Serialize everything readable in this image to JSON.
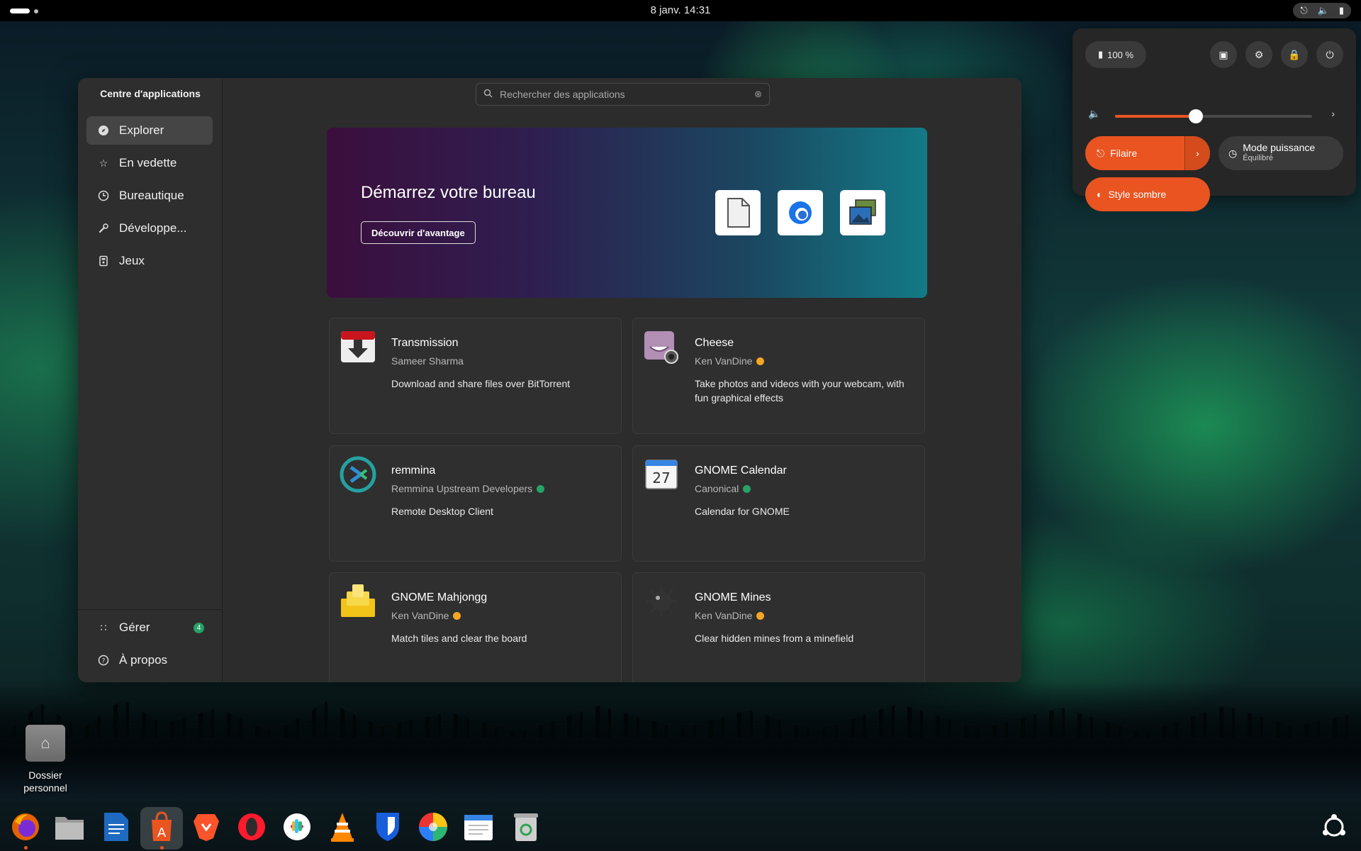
{
  "topbar": {
    "clock": "8 janv.  14:31"
  },
  "window": {
    "sidebar_title": "Centre d'applications",
    "nav": [
      {
        "label": "Explorer",
        "icon": "compass-icon",
        "active": true
      },
      {
        "label": "En vedette",
        "icon": "star-icon"
      },
      {
        "label": "Bureautique",
        "icon": "clock-icon"
      },
      {
        "label": "Développe...",
        "icon": "wrench-icon"
      },
      {
        "label": "Jeux",
        "icon": "gamepad-icon"
      }
    ],
    "nav_bottom": [
      {
        "label": "Gérer",
        "icon": "grid-icon",
        "badge": "4"
      },
      {
        "label": "À propos",
        "icon": "help-icon"
      }
    ],
    "search_placeholder": "Rechercher des applications"
  },
  "hero": {
    "title": "Démarrez votre bureau",
    "button": "Découvrir d'avantage"
  },
  "apps": [
    {
      "name": "Transmission",
      "developer": "Sameer Sharma",
      "description": "Download and share files over BitTorrent",
      "badge": ""
    },
    {
      "name": "Cheese",
      "developer": "Ken VanDine",
      "description": "Take photos and videos with your webcam, with fun graphical effects",
      "badge": "star"
    },
    {
      "name": "remmina",
      "developer": "Remmina Upstream Developers",
      "description": "Remote Desktop Client",
      "badge": "verified"
    },
    {
      "name": "GNOME Calendar",
      "developer": "Canonical",
      "description": "Calendar for GNOME",
      "badge": "verified",
      "calendar_day": "27"
    },
    {
      "name": "GNOME Mahjongg",
      "developer": "Ken VanDine",
      "description": "Match tiles and clear the board",
      "badge": "star"
    },
    {
      "name": "GNOME Mines",
      "developer": "Ken VanDine",
      "description": "Clear hidden mines from a minefield",
      "badge": "star"
    }
  ],
  "quick_settings": {
    "battery": "100 %",
    "volume_level": 0.41,
    "wired_label": "Filaire",
    "power_mode_label": "Mode puissance",
    "power_mode_value": "Équilibré",
    "dark_style_label": "Style sombre"
  },
  "desktop": {
    "home_label": "Dossier personnel"
  },
  "colors": {
    "accent": "#e95420",
    "verified": "#26a269",
    "star_badge": "#f5a623"
  }
}
